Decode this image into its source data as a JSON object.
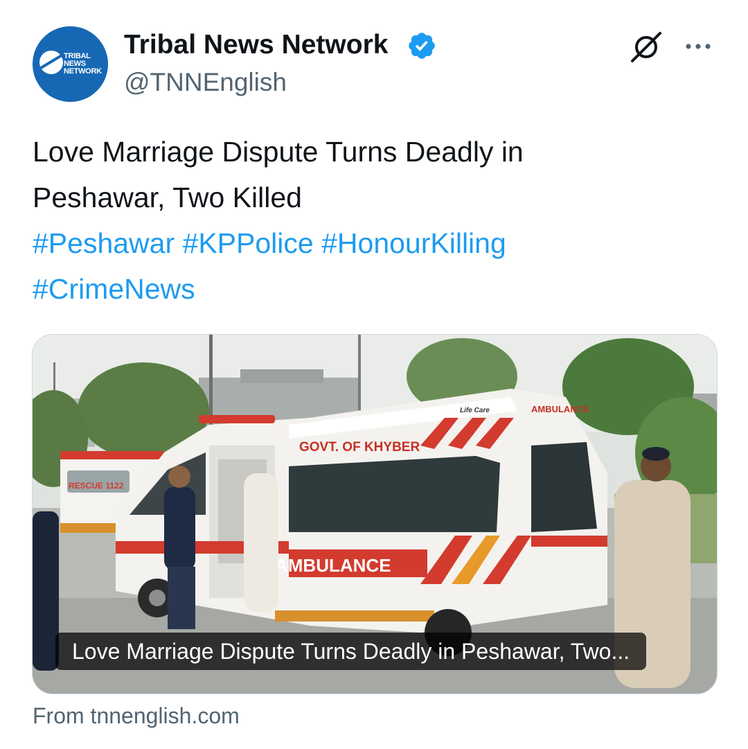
{
  "author": {
    "display_name": "Tribal News Network",
    "handle": "@TNNEnglish",
    "verified": true,
    "avatar_lines": [
      "TRIBAL",
      "NEWS",
      "NETWORK"
    ],
    "avatar_color": "#1768b4"
  },
  "actions": {
    "grok_icon": "grok-icon",
    "more_icon": "more-icon"
  },
  "tweet": {
    "text_line1": "Love Marriage Dispute Turns Deadly in",
    "text_line2": "Peshawar, Two Killed",
    "hashtags": [
      "#Peshawar",
      "#KPPolice",
      "#HonourKilling",
      "#CrimeNews"
    ]
  },
  "card": {
    "image_description_alt": "Rescue 1122 ambulances",
    "image_texts": {
      "govt": "GOVT. OF KHYBER",
      "ambulance": "AMBULANCE",
      "rescue": "RESCUE 1122",
      "life_care": "Life Care",
      "ambulance_side": "AMBULANCE"
    },
    "caption": "Love Marriage Dispute Turns Deadly in Peshawar, Two...",
    "source": "From tnnenglish.com"
  },
  "colors": {
    "hashtag": "#1d9bf0",
    "secondary_text": "#536471",
    "verified": "#1d9bf0",
    "border": "#cfd9de"
  }
}
